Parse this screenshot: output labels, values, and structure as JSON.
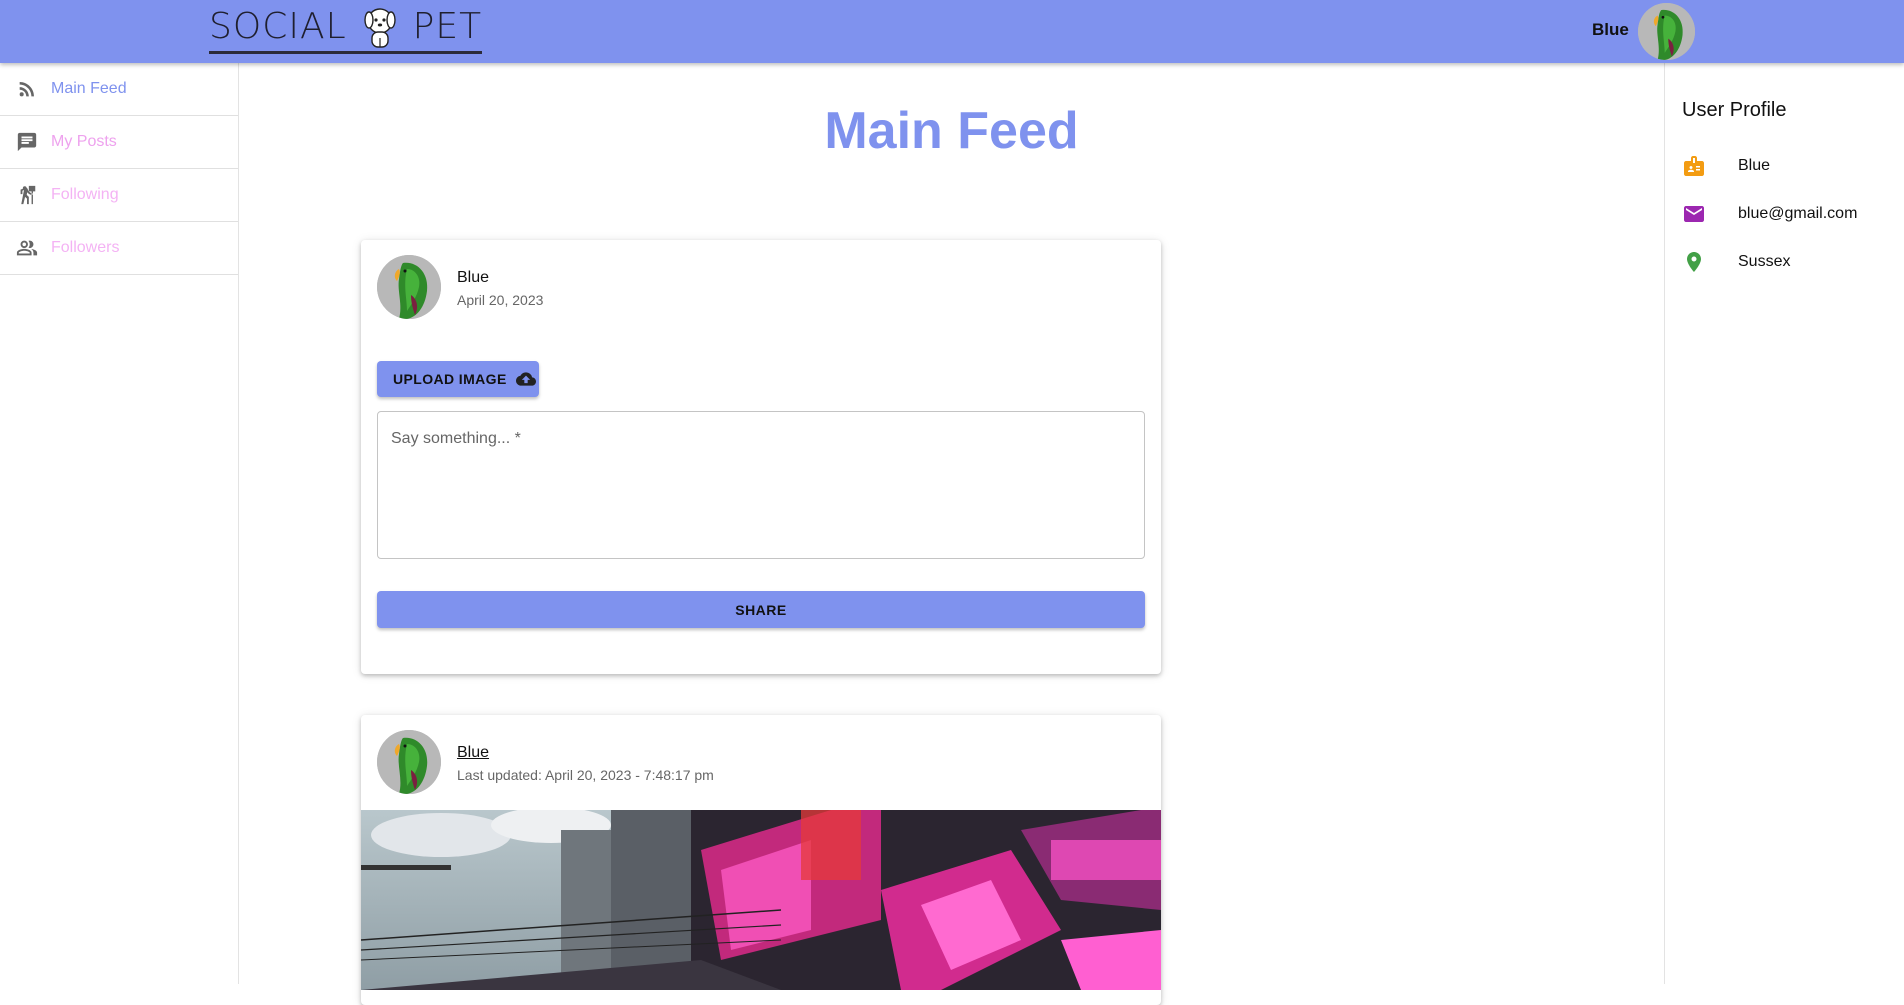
{
  "header": {
    "logo_left": "SOCIAL",
    "logo_right": "PET",
    "user_name": "Blue",
    "accent_color": "#7f92ee"
  },
  "sidebar": {
    "items": [
      {
        "label": "Main Feed",
        "icon": "rss-feed-icon",
        "color": "#7f92ee"
      },
      {
        "label": "My Posts",
        "icon": "chat-icon",
        "color": "#eea2ee"
      },
      {
        "label": "Following",
        "icon": "follow-the-signs-icon",
        "color": "#f4b3f4"
      },
      {
        "label": "Followers",
        "icon": "people-icon",
        "color": "#f4b3f4"
      }
    ]
  },
  "main": {
    "title": "Main Feed",
    "composer": {
      "user_name": "Blue",
      "date": "April 20, 2023",
      "upload_label": "UPLOAD IMAGE",
      "placeholder": "Say something... *",
      "share_label": "SHARE"
    },
    "post": {
      "user_name": "Blue",
      "updated": "Last updated: April 20, 2023 - 7:48:17 pm"
    }
  },
  "profile": {
    "title": "User Profile",
    "name": "Blue",
    "email": "blue@gmail.com",
    "location": "Sussex",
    "icon_colors": {
      "badge": "#f39c12",
      "mail": "#9c27b0",
      "place": "#43a047"
    }
  }
}
